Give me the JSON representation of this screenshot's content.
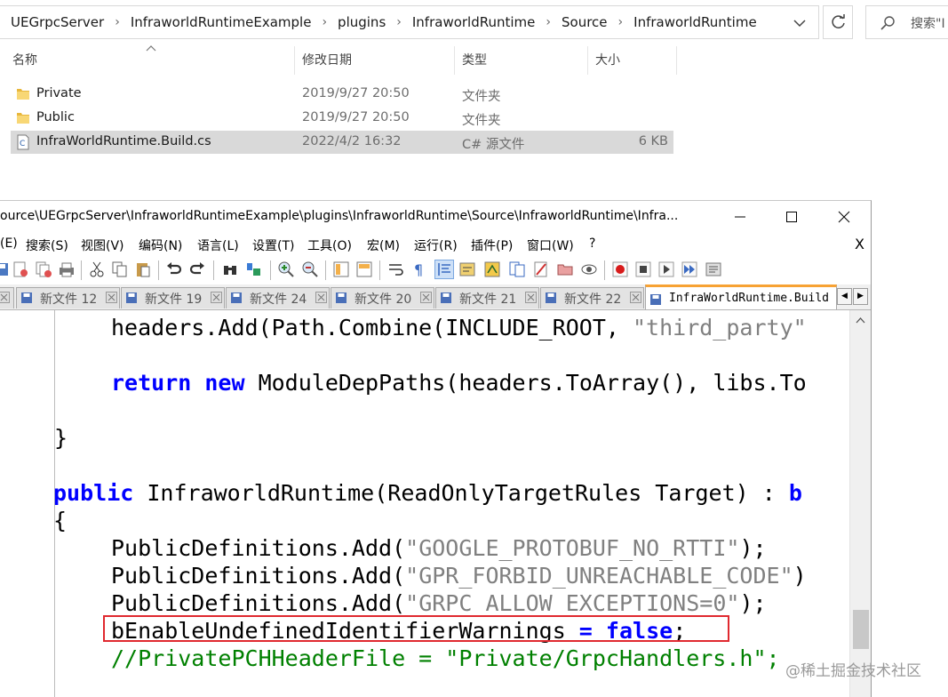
{
  "explorer": {
    "breadcrumbs": [
      "UEGrpcServer",
      "InfraworldRuntimeExample",
      "plugins",
      "InfraworldRuntime",
      "Source",
      "InfraworldRuntime"
    ],
    "search_placeholder": "搜索\"I",
    "columns": {
      "name": "名称",
      "modified": "修改日期",
      "type": "类型",
      "size": "大小"
    },
    "files": [
      {
        "icon": "folder-icon",
        "name": "Private",
        "modified": "2019/9/27 20:50",
        "type": "文件夹",
        "size": ""
      },
      {
        "icon": "folder-icon",
        "name": "Public",
        "modified": "2019/9/27 20:50",
        "type": "文件夹",
        "size": ""
      },
      {
        "icon": "csharp-file-icon",
        "name": "InfraWorldRuntime.Build.cs",
        "modified": "2022/4/2 16:32",
        "type": "C# 源文件",
        "size": "6 KB",
        "selected": true
      }
    ]
  },
  "npp": {
    "title": "ource\\UEGrpcServer\\InfraworldRuntimeExample\\plugins\\InfraworldRuntime\\Source\\InfraworldRuntime\\Infra...",
    "menu": [
      "(E)",
      "搜索(S)",
      "视图(V)",
      "编码(N)",
      "语言(L)",
      "设置(T)",
      "工具(O)",
      "宏(M)",
      "运行(R)",
      "插件(P)",
      "窗口(W)",
      "?"
    ],
    "menu_close": "X",
    "tabs": [
      {
        "label": "新文件 12"
      },
      {
        "label": "新文件 19"
      },
      {
        "label": "新文件 24"
      },
      {
        "label": "新文件 20"
      },
      {
        "label": "新文件 21"
      },
      {
        "label": "新文件 22"
      }
    ],
    "active_tab": "InfraWorldRuntime.Build",
    "tab_scroll_left": "◀",
    "tab_scroll_right": "▶",
    "code": {
      "l1": {
        "a": "headers.Add(Path.Combine(INCLUDE_ROOT, ",
        "s": "\"third_party\""
      },
      "l2": {
        "k1": "return",
        "k2": "new",
        "rest": " ModuleDepPaths(headers.ToArray(), libs.To"
      },
      "l3": "}",
      "l4": {
        "k": "public",
        "rest": " InfraworldRuntime(ReadOnlyTargetRules Target) : ",
        "k2": "b"
      },
      "l5": "{",
      "l6": {
        "a": "PublicDefinitions.Add(",
        "s": "\"GOOGLE_PROTOBUF_NO_RTTI\"",
        "b": ");"
      },
      "l7": {
        "a": "PublicDefinitions.Add(",
        "s": "\"GPR_FORBID_UNREACHABLE_CODE\"",
        "b": ")"
      },
      "l8": {
        "a": "PublicDefinitions.Add(",
        "s": "\"GRPC_ALLOW_EXCEPTIONS=0\"",
        "b": ");"
      },
      "l9": {
        "a": "bEnableUndefinedIdentifierWarnings ",
        "op": "=",
        "sp": " ",
        "k": "false",
        "b": ";"
      },
      "l10": "//PrivatePCHHeaderFile = \"Private/GrpcHandlers.h\";"
    }
  },
  "watermark": "@稀土掘金技术社区",
  "colors": {
    "keyword": "#0000ff",
    "string": "#808080",
    "comment": "#008000",
    "highlight_box": "#e0292f",
    "active_tab_accent": "#f7a234"
  }
}
